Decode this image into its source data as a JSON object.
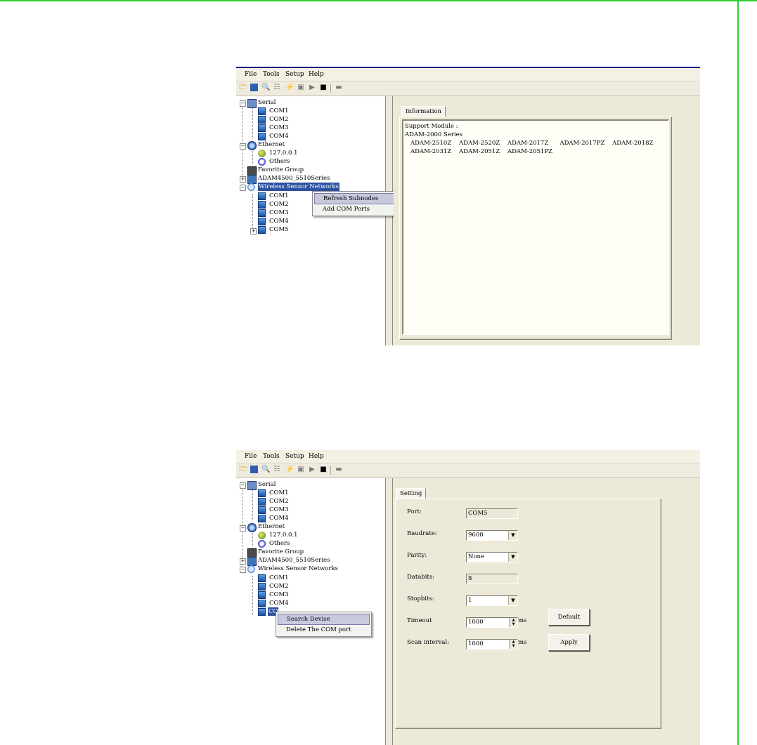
{
  "menu": [
    "File",
    "Tools",
    "Setup",
    "Help"
  ],
  "toolbar_icons": [
    "open-icon",
    "save-icon",
    "search-icon",
    "network-icon",
    "edit-icon",
    "module-icon",
    "run-icon",
    "camera-icon",
    "terminal-icon"
  ],
  "tree": {
    "serial": "Serial",
    "serial_ports": [
      "COM1",
      "COM2",
      "COM3",
      "COM4"
    ],
    "ethernet": "Ethernet",
    "ethernet_ip": "127.0.0.1",
    "ethernet_others": "Others",
    "favorite": "Favorite Group",
    "adam": "ADAM4500_5510Series",
    "wsn": "Wireless Sensor Networks",
    "wsn_ports": [
      "COM1",
      "COM2",
      "COM3",
      "COM4",
      "COM5"
    ],
    "wsn_selected_short": "CO"
  },
  "context_menu_1": {
    "items": [
      "Refresh Subnodes",
      "Add COM Ports"
    ],
    "highlighted": "Refresh Subnodes"
  },
  "context_menu_2": {
    "items": [
      "Search Devise",
      "Delete The COM port"
    ],
    "highlighted": "Search Devise"
  },
  "info_panel": {
    "tab": "Information",
    "lines": [
      "Support Module :",
      "ADAM-2000 Series",
      "ADAM-2510Z    ADAM-2520Z    ADAM-2017Z      ADAM-2017PZ    ADAM-2018Z",
      "ADAM-2031Z    ADAM-2051Z    ADAM-2051PZ"
    ]
  },
  "setting_panel": {
    "tab": "Setting",
    "port_label": "Port:",
    "port_value": "COM5",
    "baudrate_label": "Baudrate:",
    "baudrate_value": "9600",
    "parity_label": "Parity:",
    "parity_value": "None",
    "databits_label": "Databits:",
    "databits_value": "8",
    "stopbits_label": "Stopbits:",
    "stopbits_value": "1",
    "timeout_label": "Timeout",
    "timeout_value": "1000",
    "timeout_unit": "ms",
    "scan_label": "Scan interval:",
    "scan_value": "1000",
    "scan_unit": "ms",
    "default_button": "Default",
    "apply_button": "Apply"
  }
}
